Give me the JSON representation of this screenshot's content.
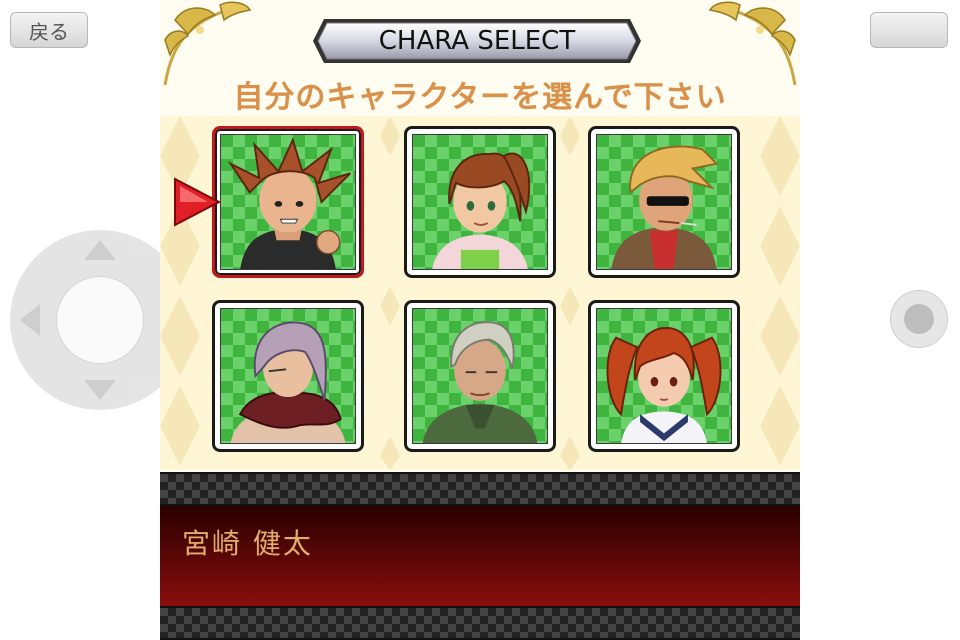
{
  "app": {
    "back_label": "戻る"
  },
  "screen": {
    "title": "CHARA SELECT",
    "instruction": "自分のキャラクターを選んで下さい",
    "selected_index": 0,
    "selected_name": "宮崎 健太",
    "characters": [
      {
        "portrait": "spiky-brown-hair-boy-portrait",
        "hair": "#a8502a",
        "shirt": "#2b2b2b"
      },
      {
        "portrait": "brown-ponytail-girl-portrait",
        "hair": "#9a4a22",
        "shirt": "#f3d6da"
      },
      {
        "portrait": "blonde-sunglasses-man-portrait",
        "hair": "#e6b85a",
        "shirt": "#7a5a3a"
      },
      {
        "portrait": "purple-hair-scarf-portrait",
        "hair": "#b6a0b8",
        "shirt": "#6e1f24"
      },
      {
        "portrait": "gray-hair-old-man-portrait",
        "hair": "#cfcfc2",
        "shirt": "#4c6a3e"
      },
      {
        "portrait": "red-twintails-girl-portrait",
        "hair": "#c2451c",
        "shirt": "#2c3a6a"
      }
    ]
  },
  "colors": {
    "accent": "#c0181c",
    "instruction": "#d9904a",
    "name": "#e0ad6a"
  }
}
